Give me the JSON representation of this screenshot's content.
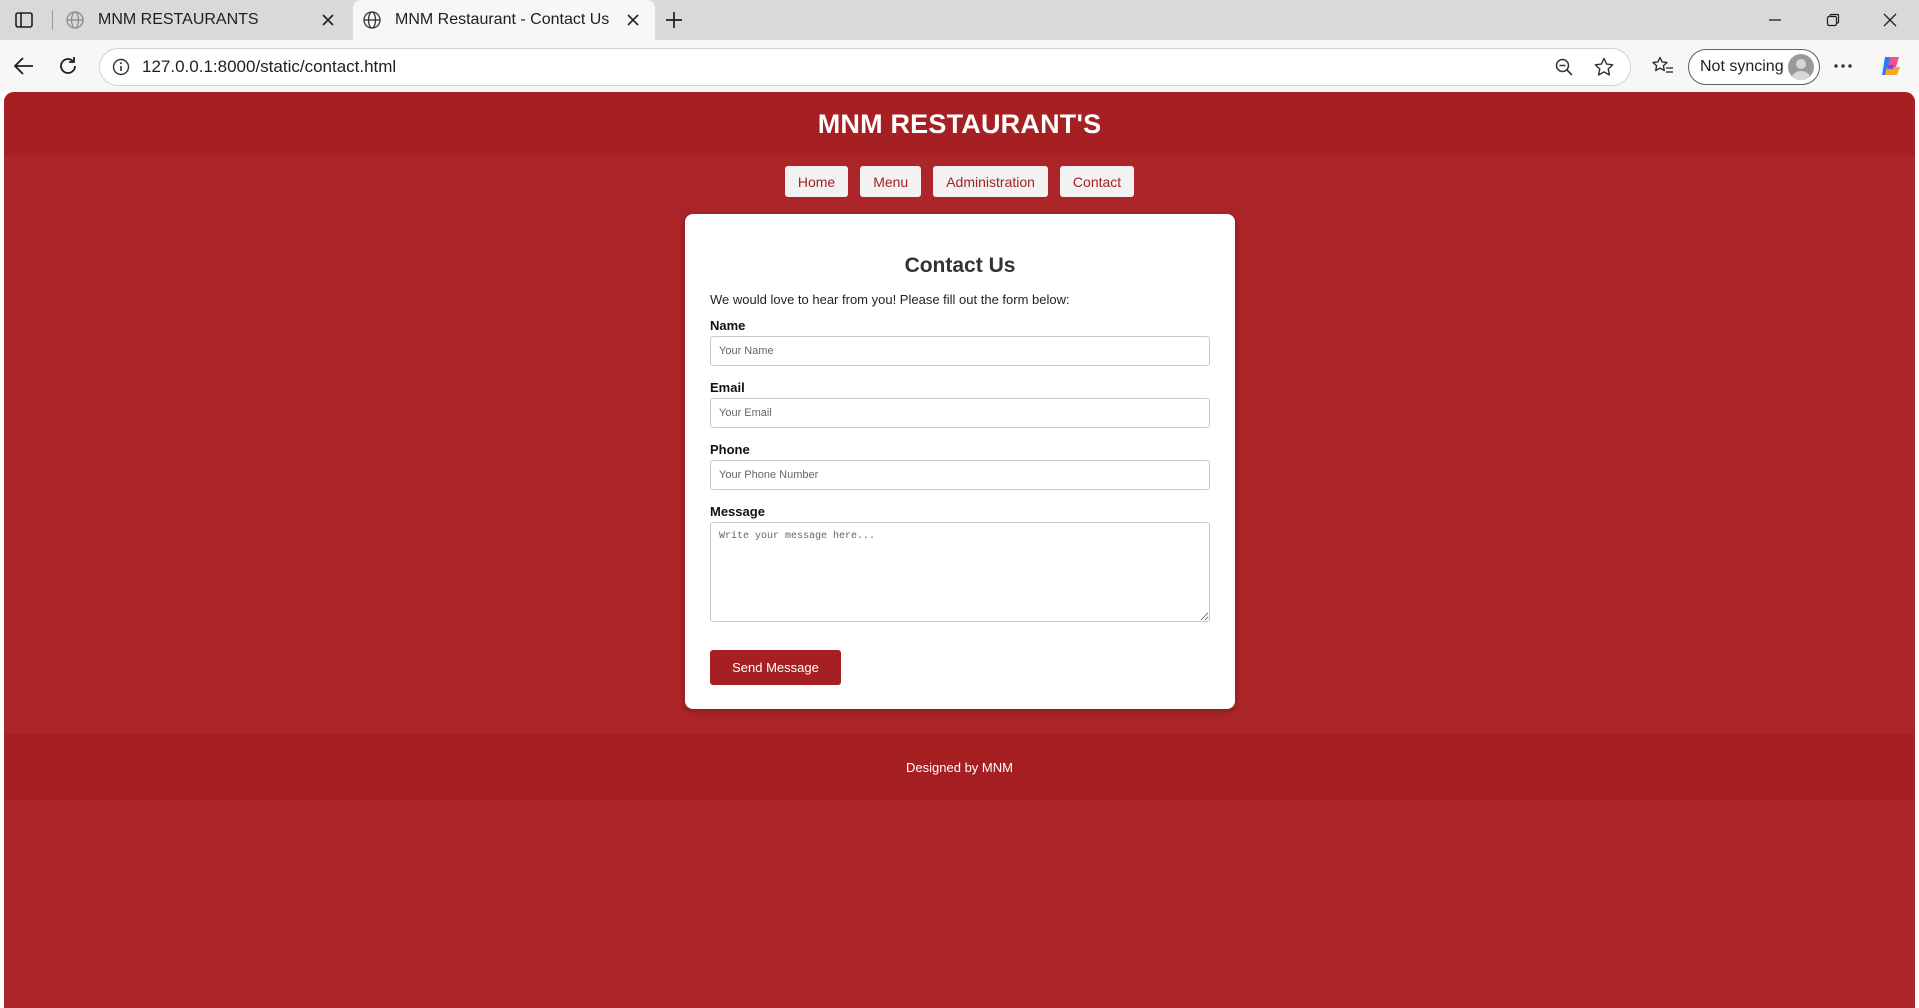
{
  "browser": {
    "tabs": [
      {
        "title": "MNM RESTAURANTS",
        "active": false
      },
      {
        "title": "MNM Restaurant - Contact Us",
        "active": true
      }
    ],
    "url": "127.0.0.1:8000/static/contact.html",
    "sync_label": "Not syncing"
  },
  "site": {
    "title": "MNM RESTAURANT'S",
    "nav": [
      "Home",
      "Menu",
      "Administration",
      "Contact"
    ],
    "accent_color": "#a61f23",
    "background_color": "#ab2529"
  },
  "form": {
    "title": "Contact Us",
    "intro": "We would love to hear from you! Please fill out the form below:",
    "fields": {
      "name": {
        "label": "Name",
        "placeholder": "Your Name"
      },
      "email": {
        "label": "Email",
        "placeholder": "Your Email"
      },
      "phone": {
        "label": "Phone",
        "placeholder": "Your Phone Number"
      },
      "message": {
        "label": "Message",
        "placeholder": "Write your message here..."
      }
    },
    "submit_label": "Send Message"
  },
  "footer": {
    "text": "Designed by MNM"
  }
}
